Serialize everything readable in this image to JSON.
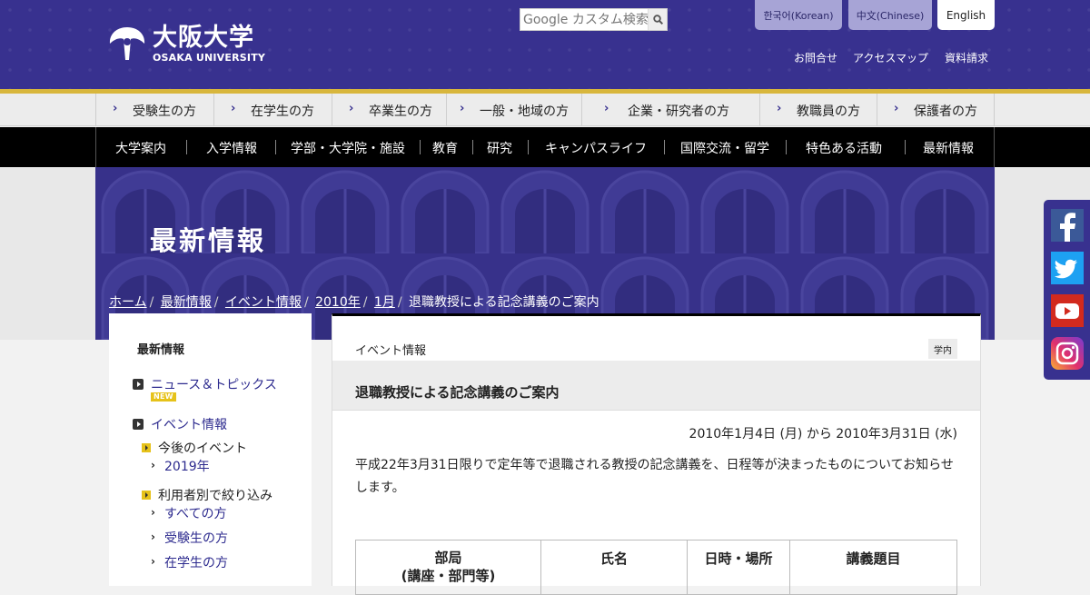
{
  "header": {
    "logo_jp": "大阪大学",
    "logo_en": "OSAKA UNIVERSITY",
    "search_placeholder": "Google カスタム検索",
    "languages": [
      "한국어(Korean)",
      "中文(Chinese)",
      "English"
    ],
    "utility_links": [
      "お問合せ",
      "アクセスマップ",
      "資料請求"
    ]
  },
  "audience_nav": [
    "受験生の方",
    "在学生の方",
    "卒業生の方",
    "一般・地域の方",
    "企業・研究者の方",
    "教職員の方",
    "保護者の方"
  ],
  "main_nav": [
    "大学案内",
    "入学情報",
    "学部・大学院・施設",
    "教育",
    "研究",
    "キャンパスライフ",
    "国際交流・留学",
    "特色ある活動",
    "最新情報"
  ],
  "hero": {
    "title": "最新情報",
    "breadcrumb": [
      "ホーム",
      "最新情報",
      "イベント情報",
      "2010年",
      "1月"
    ],
    "breadcrumb_current": "退職教授による記念講義のご案内"
  },
  "sidebar": {
    "title": "最新情報",
    "news_link": "ニュース＆トピックス",
    "new_badge": "NEW",
    "events_link": "イベント情報",
    "upcoming_label": "今後のイベント",
    "year_link": "2019年",
    "filter_label": "利用者別で絞り込み",
    "filter_links": [
      "すべての方",
      "受験生の方",
      "在学生の方"
    ]
  },
  "article": {
    "category": "イベント情報",
    "campus_tag": "学内",
    "title": "退職教授による記念講義のご案内",
    "date_range": "2010年1月4日 (月) から 2010年3月31日 (水)",
    "intro": "平成22年3月31日限りで定年等で退職される教授の記念講義を、日程等が決まったものについてお知らせします。",
    "table_headers": [
      "部局\n(講座・部門等)",
      "氏名",
      "日時・場所",
      "講義題目"
    ]
  },
  "social": [
    "facebook-icon",
    "twitter-icon",
    "youtube-icon",
    "instagram-icon"
  ],
  "colors": {
    "brand": "#38318f",
    "gold": "#d8b63c",
    "badge": "#e6c21a"
  }
}
